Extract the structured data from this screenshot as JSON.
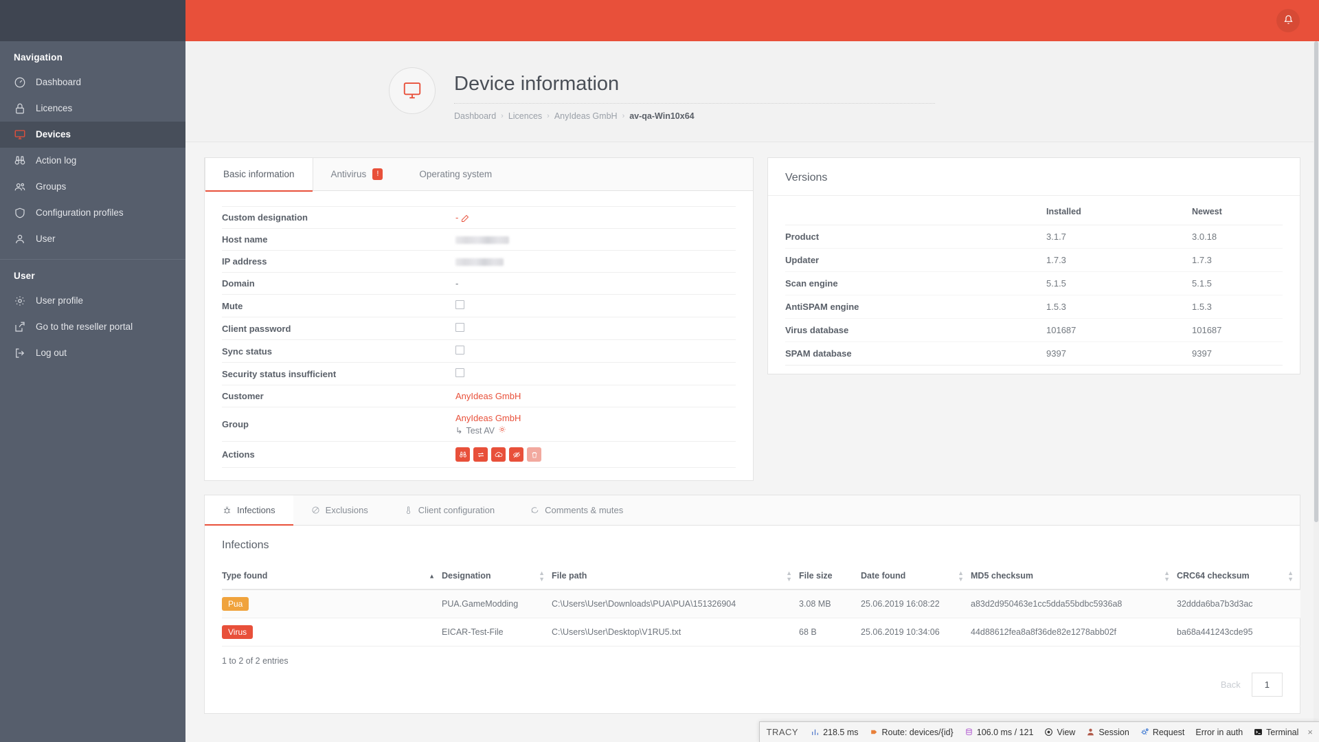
{
  "sidebar": {
    "nav_title": "Navigation",
    "nav_items": [
      {
        "label": "Dashboard",
        "icon": "gauge-icon"
      },
      {
        "label": "Licences",
        "icon": "lock-icon"
      },
      {
        "label": "Devices",
        "icon": "monitor-icon"
      },
      {
        "label": "Action log",
        "icon": "binoculars-icon"
      },
      {
        "label": "Groups",
        "icon": "users-icon"
      },
      {
        "label": "Configuration profiles",
        "icon": "shield-icon"
      },
      {
        "label": "User",
        "icon": "user-icon"
      }
    ],
    "user_title": "User",
    "user_items": [
      {
        "label": "User profile",
        "icon": "gear-icon"
      },
      {
        "label": "Go to the reseller portal",
        "icon": "external-link-icon"
      },
      {
        "label": "Log out",
        "icon": "logout-icon"
      }
    ]
  },
  "topbar": {
    "bell_icon": "bell-icon"
  },
  "header": {
    "title": "Device information",
    "avatar_icon": "monitor-icon",
    "breadcrumb": [
      "Dashboard",
      "Licences",
      "AnyIdeas GmbH",
      "av-qa-Win10x64"
    ]
  },
  "device_card": {
    "tabs": [
      {
        "label": "Basic information",
        "badge": "",
        "active": true
      },
      {
        "label": "Antivirus",
        "badge": "!",
        "active": false
      },
      {
        "label": "Operating system",
        "badge": "",
        "active": false
      }
    ],
    "rows": [
      {
        "key": "Custom designation",
        "value": "-",
        "type": "text-edit"
      },
      {
        "key": "Host name",
        "value": "",
        "type": "blurred"
      },
      {
        "key": "IP address",
        "value": "",
        "type": "blurred"
      },
      {
        "key": "Domain",
        "value": "-",
        "type": "text"
      },
      {
        "key": "Mute",
        "value": "",
        "type": "checkbox"
      },
      {
        "key": "Client password",
        "value": "",
        "type": "checkbox"
      },
      {
        "key": "Sync status",
        "value": "",
        "type": "checkbox"
      },
      {
        "key": "Security status insufficient",
        "value": "",
        "type": "checkbox"
      },
      {
        "key": "Customer",
        "value": "AnyIdeas GmbH",
        "type": "link"
      },
      {
        "key": "Group",
        "value": "AnyIdeas GmbH",
        "sub": "Test AV",
        "type": "group"
      },
      {
        "key": "Actions",
        "value": "",
        "type": "actions"
      }
    ],
    "actions": [
      {
        "name": "binoculars-icon",
        "dim": false
      },
      {
        "name": "transfer-icon",
        "dim": false
      },
      {
        "name": "cloud-upload-icon",
        "dim": false
      },
      {
        "name": "eye-off-icon",
        "dim": false
      },
      {
        "name": "trash-icon",
        "dim": true
      }
    ]
  },
  "versions": {
    "title": "Versions",
    "columns": [
      "",
      "Installed",
      "Newest"
    ],
    "rows": [
      {
        "label": "Product",
        "installed": "3.1.7",
        "newest": "3.0.18"
      },
      {
        "label": "Updater",
        "installed": "1.7.3",
        "newest": "1.7.3"
      },
      {
        "label": "Scan engine",
        "installed": "5.1.5",
        "newest": "5.1.5"
      },
      {
        "label": "AntiSPAM engine",
        "installed": "1.5.3",
        "newest": "1.5.3"
      },
      {
        "label": "Virus database",
        "installed": "101687",
        "newest": "101687"
      },
      {
        "label": "SPAM database",
        "installed": "9397",
        "newest": "9397"
      }
    ]
  },
  "lower": {
    "tabs": [
      {
        "label": "Infections",
        "icon": "bug-icon",
        "active": true
      },
      {
        "label": "Exclusions",
        "icon": "ban-icon",
        "active": false
      },
      {
        "label": "Client configuration",
        "icon": "thermometer-icon",
        "active": false
      },
      {
        "label": "Comments & mutes",
        "icon": "comment-icon",
        "active": false
      }
    ],
    "title": "Infections",
    "columns": [
      {
        "label": "Type found",
        "sort": "asc"
      },
      {
        "label": "Designation",
        "sort": "none"
      },
      {
        "label": "File path",
        "sort": "none"
      },
      {
        "label": "File size",
        "sort": "none"
      },
      {
        "label": "Date found",
        "sort": "none"
      },
      {
        "label": "MD5 checksum",
        "sort": "none"
      },
      {
        "label": "CRC64 checksum",
        "sort": "none"
      }
    ],
    "rows": [
      {
        "type": "Pua",
        "type_color": "#f0a33c",
        "designation": "PUA.GameModding",
        "file_path": "C:\\Users\\User\\Downloads\\PUA\\PUA\\151326904",
        "file_size": "3.08 MB",
        "date_found": "25.06.2019 16:08:22",
        "md5": "a83d2d950463e1cc5dda55bdbc5936a8",
        "crc64": "32ddda6ba7b3d3ac"
      },
      {
        "type": "Virus",
        "type_color": "#e8503a",
        "designation": "EICAR-Test-File",
        "file_path": "C:\\Users\\User\\Desktop\\V1RU5.txt",
        "file_size": "68 B",
        "date_found": "25.06.2019 10:34:06",
        "md5": "44d88612fea8a8f36de82e1278abb02f",
        "crc64": "ba68a441243cde95"
      }
    ],
    "entries_label": "1 to 2 of 2 entries",
    "pager": {
      "back": "Back",
      "current": "1"
    }
  },
  "tracy": {
    "logo": "TRACY",
    "items": [
      {
        "label": "218.5 ms",
        "icon": "bar-chart-icon"
      },
      {
        "label": "Route: devices/{id}",
        "icon": "arrow-right-icon"
      },
      {
        "label": "106.0 ms / 121",
        "icon": "database-icon"
      },
      {
        "label": "View",
        "icon": "target-icon"
      },
      {
        "label": "Session",
        "icon": "session-icon"
      },
      {
        "label": "Request",
        "icon": "gears-icon"
      },
      {
        "label": "Error in auth",
        "icon": ""
      },
      {
        "label": "Terminal",
        "icon": "terminal-icon"
      }
    ],
    "close": "×"
  },
  "colors": {
    "accent": "#e8503a",
    "sidebar": "#565e6c",
    "sidebar_dark": "#3f4551"
  }
}
